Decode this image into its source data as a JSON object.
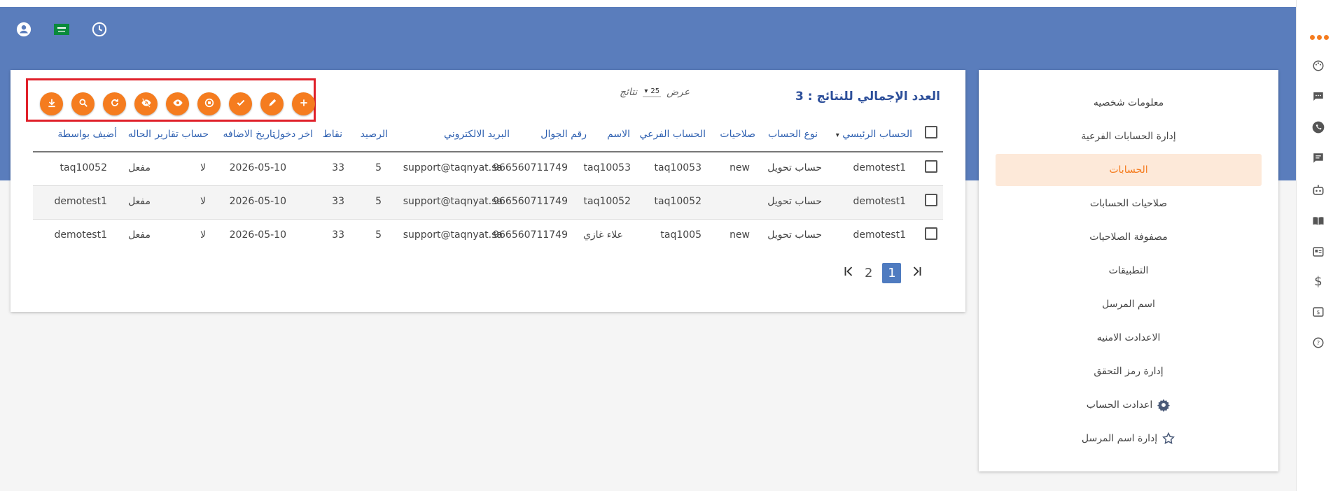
{
  "header": {
    "icons": [
      "user-circle-icon",
      "saudi-flag-icon",
      "clock-icon"
    ]
  },
  "rail": {
    "icons": [
      "more-dots-icon",
      "palette-icon",
      "chat-icon",
      "whatsapp-icon",
      "message-icon",
      "bot-icon",
      "book-icon",
      "id-card-icon",
      "dollar-icon",
      "money-icon",
      "help-icon"
    ]
  },
  "sidebar": {
    "items": [
      {
        "label": "معلومات شخصيه",
        "active": false
      },
      {
        "label": "إدارة الحسابات الفرعية",
        "active": false
      },
      {
        "label": "الحسابات",
        "active": true
      },
      {
        "label": "صلاحيات الحسابات",
        "active": false
      },
      {
        "label": "مصفوفة الصلاحيات",
        "active": false
      },
      {
        "label": "التطبيقات",
        "active": false
      },
      {
        "label": "اسم المرسل",
        "active": false
      },
      {
        "label": "الاعدادت الامنيه",
        "active": false
      },
      {
        "label": "إدارة رمز التحقق",
        "active": false
      },
      {
        "label": "اعدادت الحساب",
        "active": false,
        "icon": "gear-icon"
      },
      {
        "label": "إدارة اسم المرسل",
        "active": false,
        "icon": "star-icon"
      }
    ]
  },
  "main": {
    "result_title": "العدد الإجمالي للنتائج : 3",
    "per_page_label": "عرض",
    "per_page_value": "25",
    "per_page_suffix": "نتائج",
    "actions": [
      "download-icon",
      "search-icon",
      "refresh-icon",
      "hide-icon",
      "view-icon",
      "stop-icon",
      "check-icon",
      "edit-icon",
      "add-icon"
    ],
    "columns": [
      "الحساب الرئيسي",
      "نوع الحساب",
      "صلاحيات",
      "الحساب الفرعي",
      "الاسم",
      "رقم الجوال",
      "البريد الالكتروني",
      "الرصيد",
      "نقاط",
      "اخر دخول",
      "تاريخ الاضافه",
      "حساب تقارير",
      "الحاله",
      "أضيف بواسطة"
    ],
    "rows": [
      [
        "demotest1",
        "حساب تحويل",
        "new",
        "taq10053",
        "taq10053",
        "966560711749",
        "support@taqnyat.sa",
        "5",
        "33",
        "",
        "2026-05-10",
        "لا",
        "مفعل",
        "taq10052"
      ],
      [
        "demotest1",
        "حساب تحويل",
        "",
        "taq10052",
        "taq10052",
        "966560711749",
        "support@taqnyat.sa",
        "5",
        "33",
        "",
        "2026-05-10",
        "لا",
        "مفعل",
        "demotest1"
      ],
      [
        "demotest1",
        "حساب تحويل",
        "new",
        "taq1005",
        "علاء غازي",
        "966560711749",
        "support@taqnyat.sa",
        "5",
        "33",
        "",
        "2026-05-10",
        "لا",
        "مفعل",
        "demotest1"
      ]
    ],
    "pager": {
      "prev": "first-page-icon",
      "pages": [
        "2",
        "1"
      ],
      "current": "1",
      "next": "last-page-icon"
    }
  },
  "colors": {
    "banner": "#5a7dbc",
    "accent": "#f57c1f",
    "highlight": "#e0202a",
    "title": "#2d4f9a"
  }
}
